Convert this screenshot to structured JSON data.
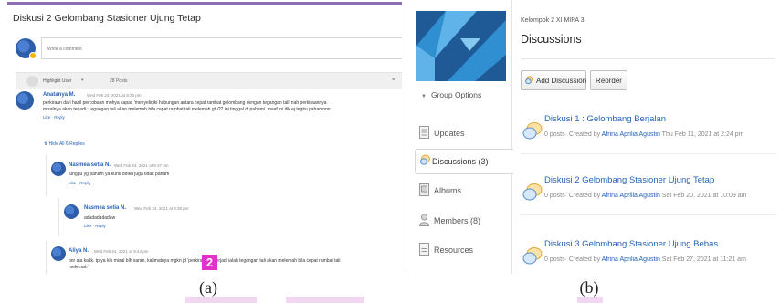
{
  "panel_a": {
    "title": "Diskusi 2 Gelombang Stasioner Ujung Tetap",
    "comment_placeholder": "Write a comment",
    "sort_label": "Highlight User",
    "posts_count": "28 Posts",
    "posts": [
      {
        "author": "Anatanya M.",
        "date": "Wed Feb 24, 2021 at 9:25 pm",
        "line1": "perkiraan dari hasil percobaan mohya kapas 'menyelidiki hubungan antara cepat rambat gelombang dengan tegangan tali' nah perkiraannya",
        "line2": "misalnya akan terjadi : tegangan tali akan melemah bila cepat rambat tali melemah gtu?? ini tinggal di pahami. maaf ini itik ej tegitu pahamnnn",
        "actions": "Like · Reply"
      }
    ],
    "hide_replies": "⇅ Hide All 6 Replies",
    "replies": [
      {
        "author": "Nasmea setia N.",
        "date": "Wed Feb 24, 2021 at 9:37 pm",
        "line1": "tunggu yg paham ya kund diriku juga tidak paham",
        "actions": "Like · Reply"
      },
      {
        "author": "Nasmea setia N.",
        "date": "Wed Feb 24, 2021 at 9:38 pm",
        "line1": "adadadadadaw",
        "actions": "Like · Reply"
      },
      {
        "author": "Aliya N.",
        "date": "Wed Feb 24, 2021 at 9:42 pm",
        "line1": "bnr aja kakk. tp ya klo misal blh saran, kalimatnya mgkn jd 'perkiraan yg terjadi ialah tegangan tali akan melemah bila cepat rambat tali",
        "line2": "melemah'"
      }
    ],
    "step_number": "2",
    "caption": "(a)"
  },
  "panel_b": {
    "breadcrumb": "Kelompok 2 XI MIPA 3",
    "page_title": "Discussions",
    "group_options": "Group Options",
    "nav": {
      "updates": "Updates",
      "discussions": "Discussions (3)",
      "albums": "Albums",
      "members": "Members (8)",
      "resources": "Resources"
    },
    "add_discussion": "Add Discussion",
    "reorder": "Reorder",
    "threads": [
      {
        "title": "Diskusi 1 : Gelombang Berjalan",
        "posts": "0 posts",
        "created_by_prefix": "· Created by ",
        "author": "Afrina Aprilia Agustin",
        "date": " Thu Feb 11, 2021 at 2:24 pm"
      },
      {
        "title": "Diskusi 2 Gelombang Stasioner Ujung Tetap",
        "posts": "0 posts",
        "created_by_prefix": "· Created by ",
        "author": "Afrina Aprilia Agustin",
        "date": " Sat Feb 20, 2021 at 10:09 am"
      },
      {
        "title": "Diskusi 3 Gelombang Stasioner Ujung Bebas",
        "posts": "0 posts",
        "created_by_prefix": "· Created by ",
        "author": "Afrina Aprilia Agustin",
        "date": " Sat Feb 27, 2021 at 11:21 am"
      }
    ],
    "caption": "(b)"
  },
  "colors": {
    "accent_purple": "#8e6db1",
    "link_blue": "#2463b5",
    "step_badge": "#e431c8",
    "logo_dark": "#1f5a96",
    "logo_light": "#2f8fd0"
  }
}
